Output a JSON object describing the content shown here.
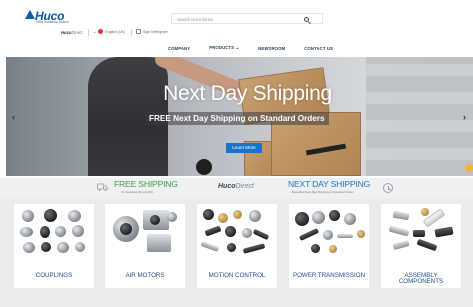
{
  "header": {
    "logo_text": "Huco",
    "tagline": "Altra Industrial Motion",
    "sub_logo_brand": "Huco",
    "sub_logo_suffix": "Direct",
    "locale_label": "English (UK)",
    "account_label": "Sign In/Register",
    "search_placeholder": "Search Huco Direct"
  },
  "nav": {
    "items": [
      {
        "label": "COMPANY"
      },
      {
        "label": "PRODUCTS ⌄"
      },
      {
        "label": "NEWSROOM"
      },
      {
        "label": "CONTACT US"
      }
    ]
  },
  "hero": {
    "title": "Next Day Shipping",
    "subtitle": "FREE Next Day Shipping on Standard Orders",
    "button_label": "Learn More",
    "prev_arrow": "‹",
    "next_arrow": "›"
  },
  "shipping": {
    "left_title": "FREE SHIPPING",
    "left_sub": "On Standard UK and ROI",
    "middle_brand": "Huco",
    "middle_suffix": "Direct",
    "right_title": "NEXT DAY SHIPPING",
    "right_sub": "Expedited Next Day Shipping on Standard Orders"
  },
  "categories": [
    {
      "label": "COUPLINGS"
    },
    {
      "label": "AIR MOTORS"
    },
    {
      "label": "MOTION CONTROL"
    },
    {
      "label": "POWER TRANSMISSION"
    },
    {
      "label_line1": "ASSEMBLY",
      "label_line2": "COMPONENTS"
    }
  ],
  "colors": {
    "brand_blue": "#0e5aa7",
    "shipping_green": "#3ba148",
    "shipping_blue": "#1b78c4",
    "button_blue": "#1a73c9"
  },
  "icons": [
    "logo-triangle-icon",
    "chevron-icon",
    "flag-icon",
    "user-icon",
    "search-icon",
    "truck-icon",
    "clock-icon",
    "arrow-left-icon",
    "arrow-right-icon"
  ]
}
